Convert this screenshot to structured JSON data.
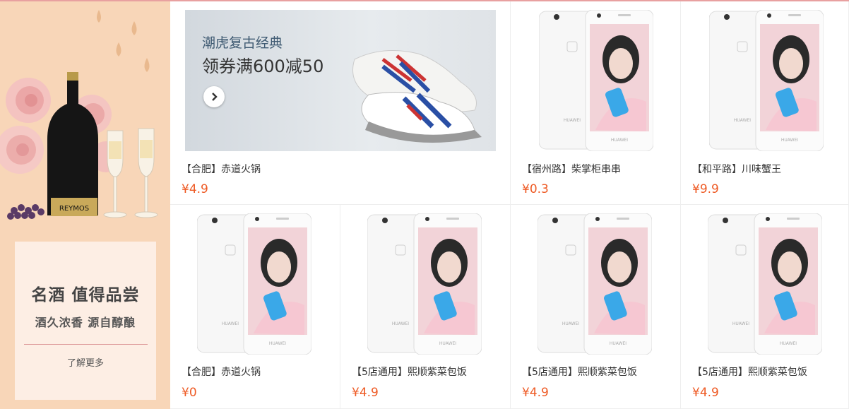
{
  "promo": {
    "title": "名酒 值得品尝",
    "subtitle": "酒久浓香 源自醇酿",
    "more": "了解更多",
    "bottle_label": "REYMOS",
    "bottle_neck": "REYMOS"
  },
  "banner": {
    "line1": "潮虎复古经典",
    "line2": "领券满600减50",
    "arrow_icon": "chevron-right-icon"
  },
  "phone_brand": "HUAWEI",
  "products": [
    {
      "title": "【合肥】赤道火锅",
      "price": "¥4.9"
    },
    {
      "title": "【宿州路】柴掌柜串串",
      "price": "¥0.3"
    },
    {
      "title": "【和平路】川味蟹王",
      "price": "¥9.9"
    },
    {
      "title": "【合肥】赤道火锅",
      "price": "¥0"
    },
    {
      "title": "【5店通用】熙顺紫菜包饭",
      "price": "¥4.9"
    },
    {
      "title": "【5店通用】熙顺紫菜包饭",
      "price": "¥4.9"
    },
    {
      "title": "【5店通用】熙顺紫菜包饭",
      "price": "¥4.9"
    }
  ]
}
